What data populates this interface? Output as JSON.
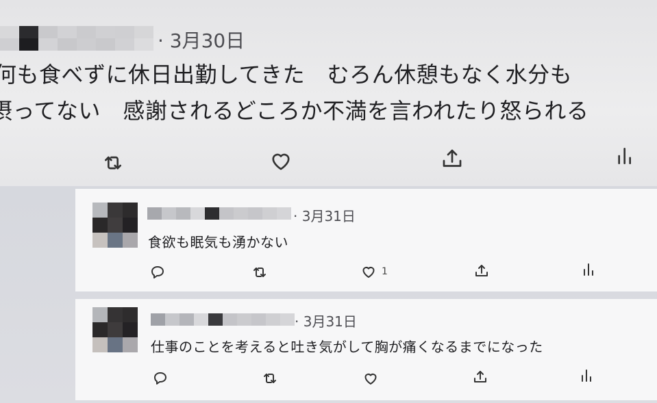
{
  "main_tweet": {
    "time": "· 3月30日",
    "line1": "何も食べずに休日出勤してきた　むろん休憩もなく水分も",
    "line2": "摂ってない　感謝されるどころか不満を言われたり怒られる"
  },
  "replies": [
    {
      "time": "· 3月31日",
      "text": "食欲も眠気も湧かない",
      "like_count": "1"
    },
    {
      "time": "· 3月31日",
      "text": "仕事のことを考えると吐き気がして胸が痛くなるまでになった",
      "like_count": ""
    }
  ],
  "icons": {
    "reply": "reply-icon",
    "retweet": "retweet-icon",
    "like": "heart-icon",
    "share": "share-icon",
    "views": "views-icon"
  },
  "colors": {
    "text": "#1f1f22",
    "meta": "#4d4d52",
    "icon": "#333333"
  }
}
